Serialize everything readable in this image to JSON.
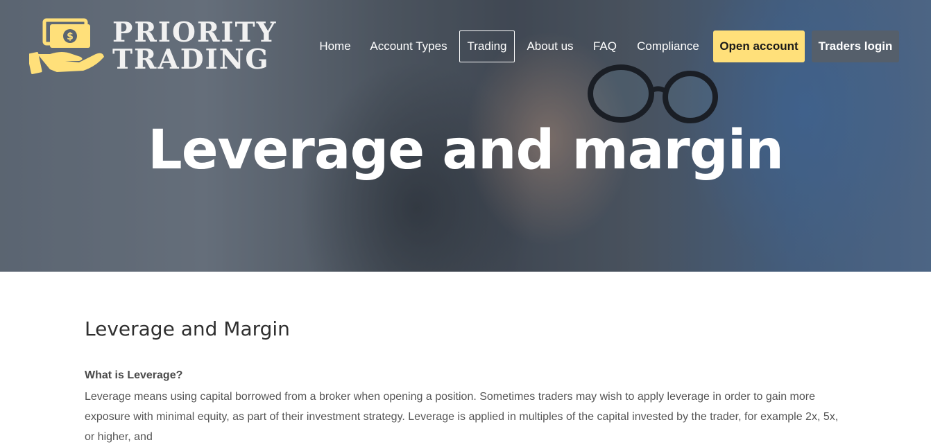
{
  "brand": {
    "line1": "PRIORITY",
    "line2": "TRADING",
    "icon": "hand-holding-money-icon",
    "accent_color": "#ffe07a"
  },
  "nav": {
    "items": [
      "Home",
      "Account Types",
      "Trading",
      "About us",
      "FAQ",
      "Compliance"
    ],
    "active": "Trading",
    "open_account_label": "Open account",
    "traders_login_label": "Traders login"
  },
  "hero": {
    "title": "Leverage and margin"
  },
  "content": {
    "title": "Leverage and Margin",
    "subheading": "What is Leverage?",
    "paragraph": "Leverage means using capital borrowed from a broker when opening a position. Sometimes traders may wish to apply leverage in order to gain more exposure with minimal equity, as part of their investment strategy. Leverage is applied in multiples of the capital invested by the trader, for example 2x, 5x, or higher, and"
  }
}
